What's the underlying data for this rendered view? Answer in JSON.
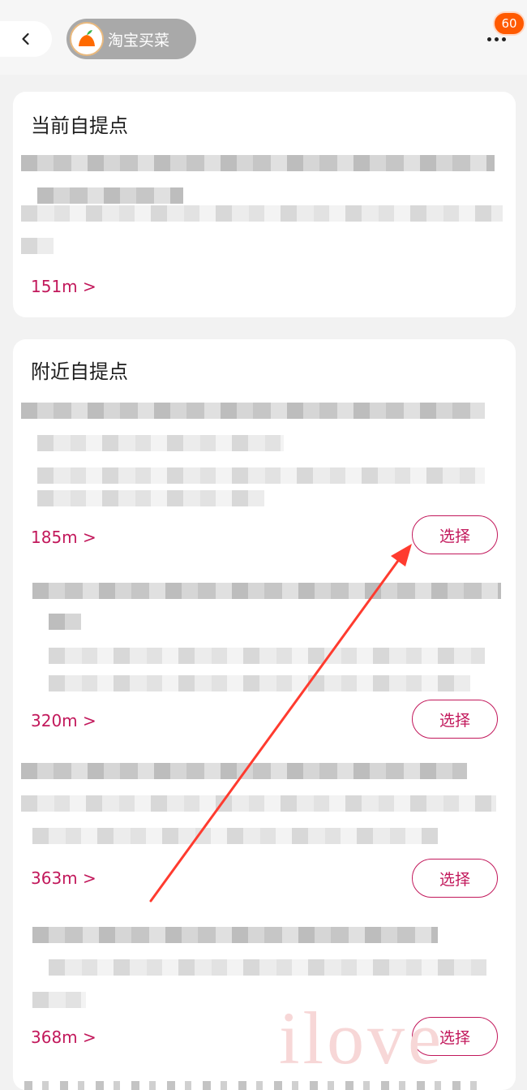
{
  "header": {
    "back_icon": "chevron-left-icon",
    "app_name": "淘宝买菜",
    "app_logo_icon": "orange-fruit-icon",
    "more_icon": "more-dots-icon",
    "badge_count": "60"
  },
  "current_pickup": {
    "title": "当前自提点",
    "distance": "151m >"
  },
  "nearby_pickup": {
    "title": "附近自提点",
    "items": [
      {
        "distance": "185m >",
        "select_label": "选择"
      },
      {
        "distance": "320m >",
        "select_label": "选择"
      },
      {
        "distance": "363m >",
        "select_label": "选择"
      },
      {
        "distance": "368m >",
        "select_label": "选择"
      }
    ]
  },
  "colors": {
    "accent": "#c2185b",
    "badge": "#ff5a00",
    "arrow": "#ff3b2f"
  }
}
